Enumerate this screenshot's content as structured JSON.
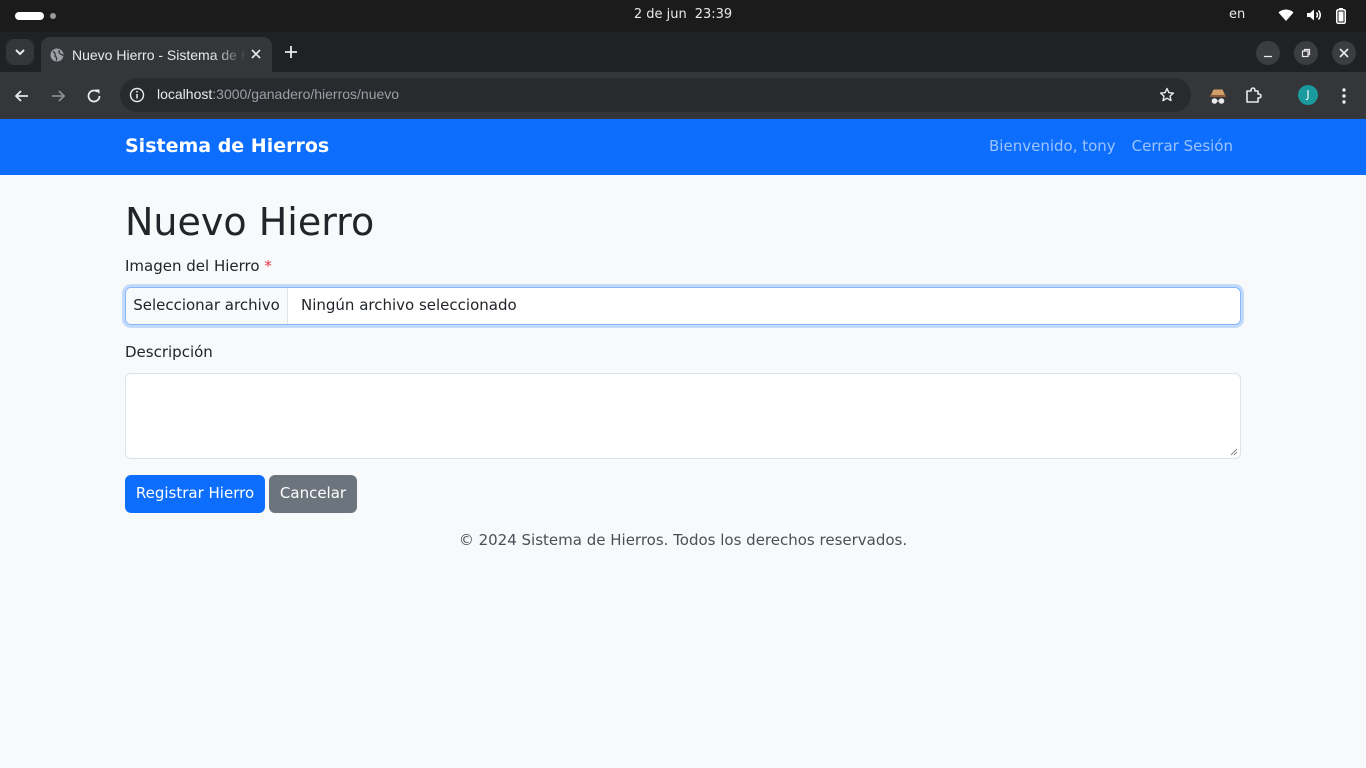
{
  "os": {
    "date": "2 de jun",
    "time": "23:39",
    "lang": "en"
  },
  "browser": {
    "tab_title": "Nuevo Hierro - Sistema de Hierros",
    "url_host": "localhost",
    "url_path": ":3000/ganadero/hierros/nuevo",
    "profile_initial": "J"
  },
  "navbar": {
    "brand": "Sistema de Hierros",
    "welcome": "Bienvenido, tony",
    "logout": "Cerrar Sesión",
    "color": "#0d6efd"
  },
  "form": {
    "title": "Nuevo Hierro",
    "image_label": "Imagen del Hierro",
    "required_mark": "*",
    "file_button": "Seleccionar archivo",
    "file_status": "Ningún archivo seleccionado",
    "description_label": "Descripción",
    "description_value": "",
    "submit_label": "Registrar Hierro",
    "cancel_label": "Cancelar"
  },
  "footer": {
    "text": "© 2024 Sistema de Hierros. Todos los derechos reservados."
  }
}
